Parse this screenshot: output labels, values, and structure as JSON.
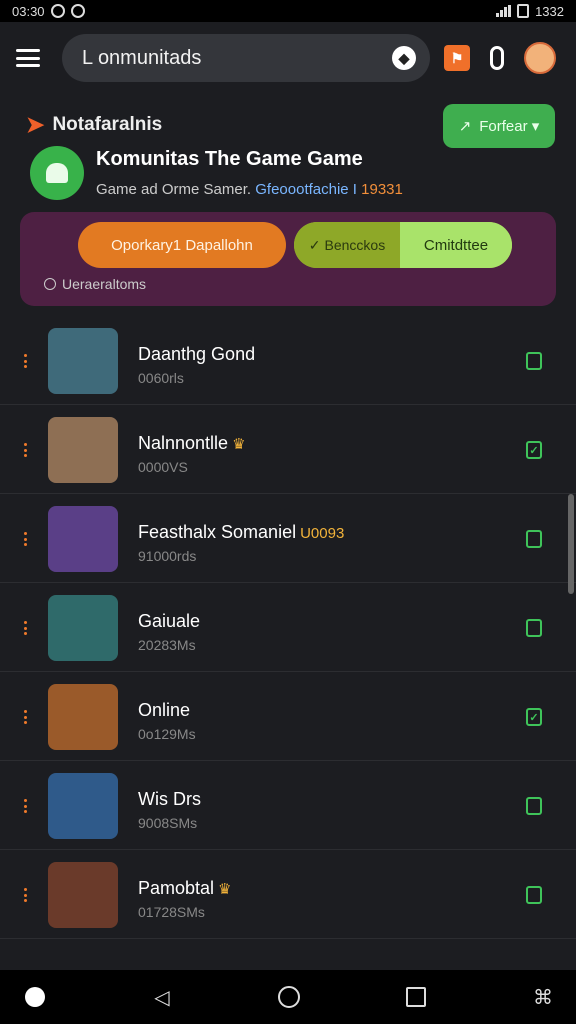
{
  "status": {
    "time": "03:30",
    "right_text": "1332"
  },
  "search": {
    "value": "L onmunitads"
  },
  "section": {
    "title": "Notafaralnis"
  },
  "follow_button": {
    "label": "Forfear ▾"
  },
  "community": {
    "name": "Komunitas The Game Game",
    "subtitle_a": "Game ad Orme Samer.",
    "subtitle_link": "Gfeoootfachie I",
    "subtitle_num": "19331"
  },
  "actions": {
    "primary": "Oporkary1 Dapallohn",
    "toggle_left": "Bencckos",
    "toggle_right": "Cmitdttee",
    "note": "Ueraeraltoms"
  },
  "games": [
    {
      "name": "Daanthg Gond",
      "badge": "",
      "sub": "0060rls",
      "thumb": "#3f6a7a",
      "checked": false
    },
    {
      "name": "Nalnnontlle",
      "badge": "♛",
      "sub": "0000VS",
      "thumb": "#8e6f54",
      "checked": true
    },
    {
      "name": "Feasthalx Somaniel",
      "badge": "U0093",
      "sub": "91000rds",
      "thumb": "#5a3f87",
      "checked": false
    },
    {
      "name": "Gaiuale",
      "badge": "",
      "sub": "20283Ms",
      "thumb": "#2f6a6a",
      "checked": false
    },
    {
      "name": "Online",
      "badge": "",
      "sub": "0o129Ms",
      "thumb": "#9a5a2a",
      "checked": true
    },
    {
      "name": "Wis Drs",
      "badge": "",
      "sub": "9008SMs",
      "thumb": "#2f5a8a",
      "checked": false
    },
    {
      "name": "Pamobtal",
      "badge": "♛",
      "sub": "01728SMs",
      "thumb": "#6a3a2a",
      "checked": false
    }
  ]
}
